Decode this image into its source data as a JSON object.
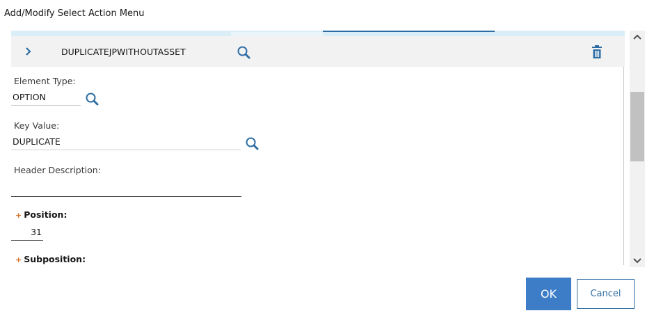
{
  "dialog": {
    "title": "Add/Modify Select Action Menu"
  },
  "row": {
    "name": "DUPLICATEJPWITHOUTASSET"
  },
  "fields": {
    "element_type": {
      "label": "Element Type:",
      "value": "OPTION"
    },
    "key_value": {
      "label": "Key Value:",
      "value": "DUPLICATE"
    },
    "header_description": {
      "label": "Header Description:",
      "value": ""
    },
    "position": {
      "label": "Position:",
      "value": "31"
    },
    "subposition": {
      "label": "Subposition:"
    }
  },
  "required_mark": "+",
  "buttons": {
    "ok": "OK",
    "cancel": "Cancel"
  },
  "colors": {
    "primary": "#3d7dc8",
    "link": "#2e6da4",
    "required": "#da6b1e",
    "row_bg": "#f2f2f2"
  }
}
